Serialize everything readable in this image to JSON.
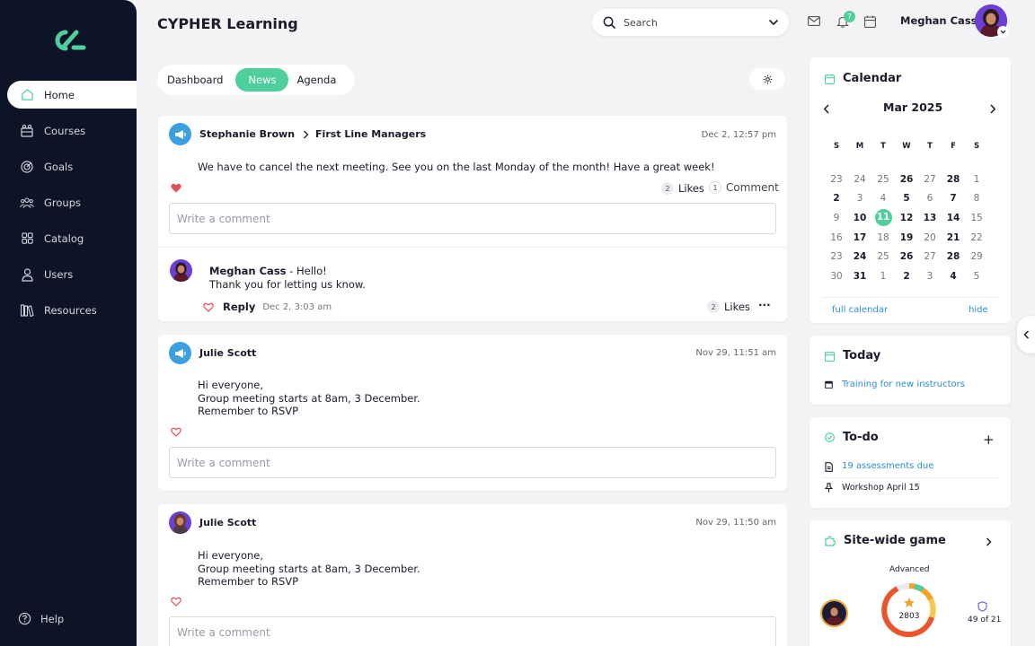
{
  "app_title": "CYPHER Learning",
  "sidebar": {
    "items": [
      {
        "label": "Home",
        "icon": "home-icon"
      },
      {
        "label": "Courses",
        "icon": "courses-icon"
      },
      {
        "label": "Goals",
        "icon": "goals-icon"
      },
      {
        "label": "Groups",
        "icon": "groups-icon"
      },
      {
        "label": "Catalog",
        "icon": "catalog-icon"
      },
      {
        "label": "Users",
        "icon": "users-icon"
      },
      {
        "label": "Resources",
        "icon": "resources-icon"
      }
    ],
    "help_label": "Help"
  },
  "header": {
    "search_placeholder": "Search",
    "notification_count": "7",
    "user_name": "Meghan Cass"
  },
  "tabs": [
    {
      "label": "Dashboard",
      "active": false
    },
    {
      "label": "News",
      "active": true
    },
    {
      "label": "Agenda",
      "active": false
    }
  ],
  "posts": [
    {
      "author": "Stephanie Brown",
      "target": "First Line Managers",
      "date": "Dec 2, 12:57 pm",
      "text": "We have to cancel the next meeting. See you on the last Monday of the month! Have a great week!",
      "likes_count": "2",
      "likes_label": "Likes",
      "comment_count": "1",
      "comment_label": "Comment",
      "comment_placeholder": "Write a comment",
      "reply": {
        "author": "Meghan Cass",
        "line1": " - Hello!",
        "line2": "Thank you for letting us know.",
        "reply_label": "Reply",
        "date": "Dec 2, 3:03 am",
        "likes_count": "2",
        "likes_label": "Likes"
      }
    },
    {
      "author": "Julie Scott",
      "date": "Nov 29, 11:51 am",
      "lines": [
        "Hi everyone,",
        "Group meeting starts at 8am, 3 December.",
        "Remember to RSVP"
      ],
      "comment_placeholder": "Write a comment"
    },
    {
      "author": "Julie Scott",
      "date": "Nov 29, 11:50 am",
      "lines": [
        "Hi everyone,",
        "Group meeting starts at 8am, 3 December.",
        "Remember to RSVP"
      ],
      "comment_placeholder": "Write a comment"
    }
  ],
  "calendar": {
    "title": "Calendar",
    "month": "Mar 2025",
    "weekdays": [
      "S",
      "M",
      "T",
      "W",
      "T",
      "F",
      "S"
    ],
    "weeks": [
      [
        {
          "d": "23"
        },
        {
          "d": "24"
        },
        {
          "d": "25"
        },
        {
          "d": "26",
          "b": true
        },
        {
          "d": "27"
        },
        {
          "d": "28",
          "b": true
        },
        {
          "d": "1"
        }
      ],
      [
        {
          "d": "2",
          "b": true
        },
        {
          "d": "3"
        },
        {
          "d": "4"
        },
        {
          "d": "5",
          "b": true
        },
        {
          "d": "6"
        },
        {
          "d": "7",
          "b": true
        },
        {
          "d": "8"
        }
      ],
      [
        {
          "d": "9"
        },
        {
          "d": "10",
          "b": true
        },
        {
          "d": "11",
          "today": true
        },
        {
          "d": "12",
          "b": true
        },
        {
          "d": "13",
          "b": true
        },
        {
          "d": "14",
          "b": true
        },
        {
          "d": "15"
        }
      ],
      [
        {
          "d": "16"
        },
        {
          "d": "17",
          "b": true
        },
        {
          "d": "18"
        },
        {
          "d": "19",
          "b": true
        },
        {
          "d": "20"
        },
        {
          "d": "21",
          "b": true
        },
        {
          "d": "22"
        }
      ],
      [
        {
          "d": "23"
        },
        {
          "d": "24",
          "b": true
        },
        {
          "d": "25"
        },
        {
          "d": "26",
          "b": true
        },
        {
          "d": "27"
        },
        {
          "d": "28",
          "b": true
        },
        {
          "d": "29"
        }
      ],
      [
        {
          "d": "30"
        },
        {
          "d": "31",
          "b": true
        },
        {
          "d": "1"
        },
        {
          "d": "2",
          "b": true
        },
        {
          "d": "3"
        },
        {
          "d": "4",
          "b": true
        },
        {
          "d": "5"
        }
      ]
    ],
    "full_calendar_label": "full calendar",
    "hide_label": "hide"
  },
  "today": {
    "title": "Today",
    "event": "Training for new instructors"
  },
  "todo": {
    "title": "To-do",
    "items": [
      "19 assessments due",
      "Workshop April 15"
    ]
  },
  "game": {
    "title": "Site-wide game",
    "level": "Advanced",
    "points": "2803",
    "rank": "49 of 21"
  },
  "colors": {
    "sidebar_bg": "#0d1427",
    "accent": "#4fcf9b",
    "link": "#2a8fd4",
    "heart": "#e0505a"
  }
}
